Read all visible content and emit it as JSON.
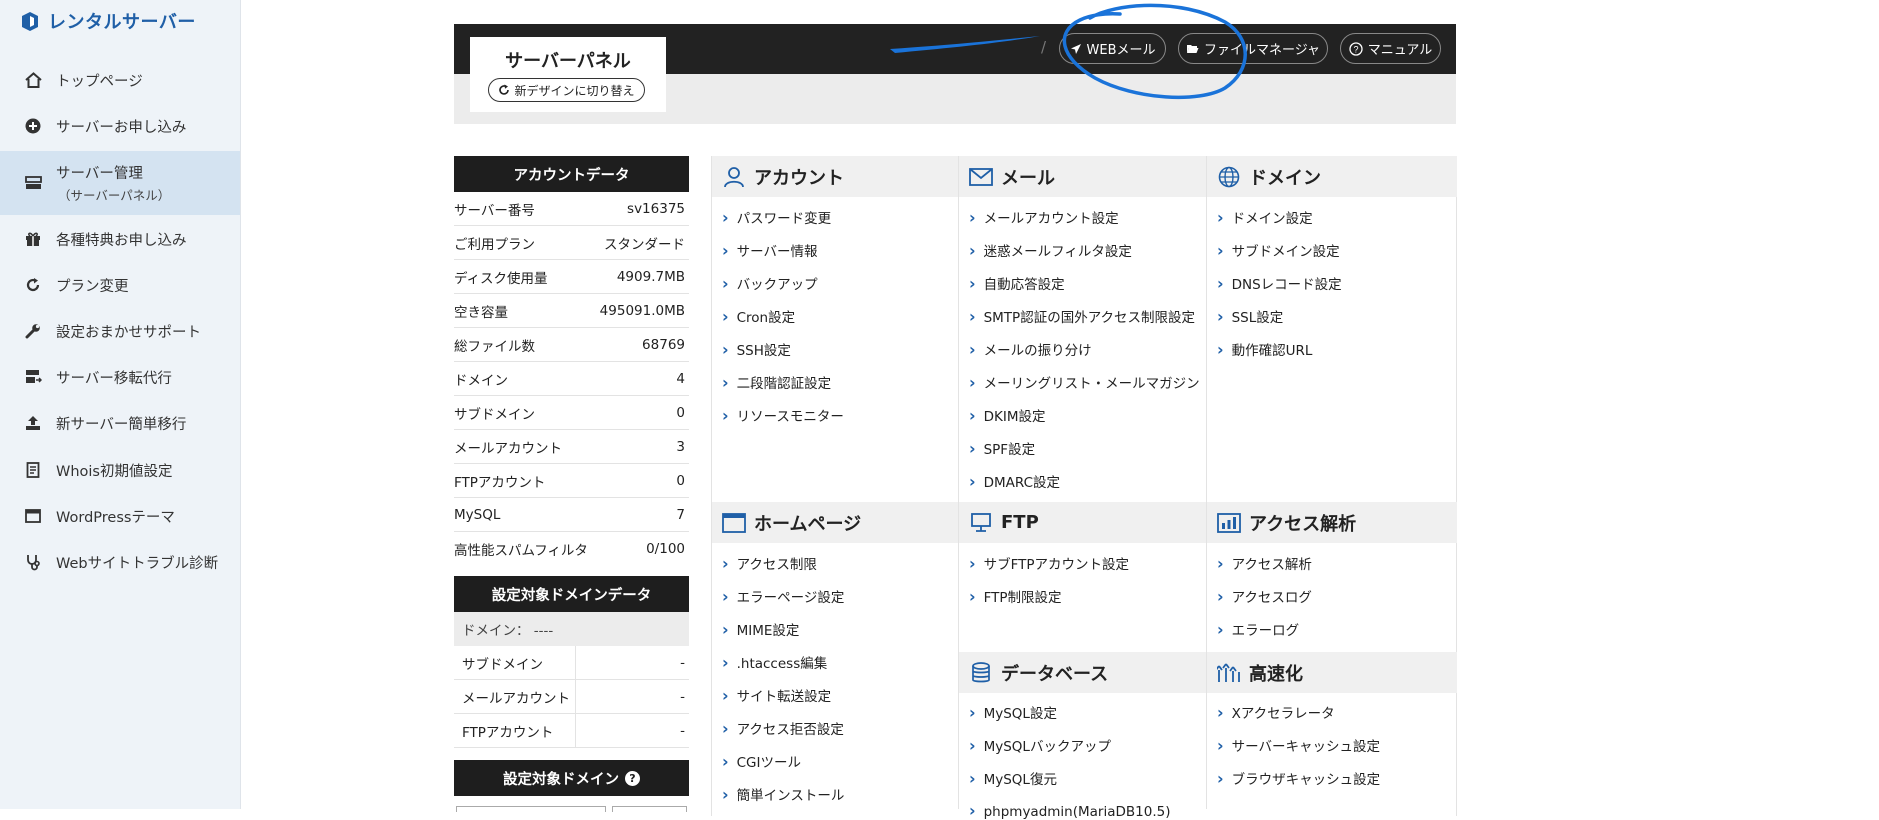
{
  "sidebar": {
    "brand": "レンタルサーバー",
    "items": [
      {
        "label": "トップページ",
        "icon": "home-icon"
      },
      {
        "label": "サーバーお申し込み",
        "icon": "plus-circle-icon"
      },
      {
        "label": "サーバー管理",
        "sub": "（サーバーパネル）",
        "icon": "server-icon",
        "active": true
      },
      {
        "label": "各種特典お申し込み",
        "icon": "gift-icon"
      },
      {
        "label": "プラン変更",
        "icon": "refresh-icon"
      },
      {
        "label": "設定おまかせサポート",
        "icon": "wrench-icon"
      },
      {
        "label": "サーバー移転代行",
        "icon": "server-transfer-icon"
      },
      {
        "label": "新サーバー簡単移行",
        "icon": "upload-icon"
      },
      {
        "label": "Whois初期値設定",
        "icon": "document-icon"
      },
      {
        "label": "WordPressテーマ",
        "icon": "window-icon"
      },
      {
        "label": "Webサイトトラブル診断",
        "icon": "diagnose-icon"
      }
    ]
  },
  "header": {
    "title": "サーバーパネル",
    "switch_label": "新デザインに切り替え",
    "slash": "/",
    "webmail_label": "WEBメール",
    "filemanager_label": "ファイルマネージャ",
    "manual_label": "マニュアル"
  },
  "account": {
    "heading": "アカウントデータ",
    "rows": [
      {
        "k": "サーバー番号",
        "v": "sv16375"
      },
      {
        "k": "ご利用プラン",
        "v": "スタンダード"
      },
      {
        "k": "ディスク使用量",
        "v": "4909.7MB"
      },
      {
        "k": "空き容量",
        "v": "495091.0MB"
      },
      {
        "k": "総ファイル数",
        "v": "68769"
      },
      {
        "k": "ドメイン",
        "v": "4"
      },
      {
        "k": "サブドメイン",
        "v": "0"
      },
      {
        "k": "メールアカウント",
        "v": "3"
      },
      {
        "k": "FTPアカウント",
        "v": "0"
      },
      {
        "k": "MySQL",
        "v": "7"
      },
      {
        "k": "高性能スパムフィルタ",
        "v": "0/100"
      }
    ]
  },
  "domain_data": {
    "heading": "設定対象ドメインデータ",
    "domain_line": "ドメイン： ----",
    "rows": [
      {
        "k": "サブドメイン",
        "v": "-"
      },
      {
        "k": "メールアカウント",
        "v": "-"
      },
      {
        "k": "FTPアカウント",
        "v": "-"
      }
    ]
  },
  "target_domain": {
    "heading": "設定対象ドメイン",
    "help": "?"
  },
  "sections": {
    "account": {
      "title": "アカウント",
      "links": [
        "パスワード変更",
        "サーバー情報",
        "バックアップ",
        "Cron設定",
        "SSH設定",
        "二段階認証設定",
        "リソースモニター"
      ]
    },
    "mail": {
      "title": "メール",
      "links": [
        "メールアカウント設定",
        "迷惑メールフィルタ設定",
        "自動応答設定",
        "SMTP認証の国外アクセス制限設定",
        "メールの振り分け",
        "メーリングリスト・メールマガジン",
        "DKIM設定",
        "SPF設定",
        "DMARC設定"
      ]
    },
    "domain": {
      "title": "ドメイン",
      "links": [
        "ドメイン設定",
        "サブドメイン設定",
        "DNSレコード設定",
        "SSL設定",
        "動作確認URL"
      ]
    },
    "homepage": {
      "title": "ホームページ",
      "links": [
        "アクセス制限",
        "エラーページ設定",
        "MIME設定",
        ".htaccess編集",
        "サイト転送設定",
        "アクセス拒否設定",
        "CGIツール",
        "簡単インストール"
      ]
    },
    "ftp": {
      "title": "FTP",
      "links": [
        "サブFTPアカウント設定",
        "FTP制限設定"
      ]
    },
    "analytics": {
      "title": "アクセス解析",
      "links": [
        "アクセス解析",
        "アクセスログ",
        "エラーログ"
      ]
    },
    "database": {
      "title": "データベース",
      "links": [
        "MySQL設定",
        "MySQLバックアップ",
        "MySQL復元",
        "phpmyadmin(MariaDB10.5)"
      ]
    },
    "speed": {
      "title": "高速化",
      "links": [
        "Xアクセラレータ",
        "サーバーキャッシュ設定",
        "ブラウザキャッシュ設定"
      ]
    }
  },
  "colors": {
    "accent": "#1f5fa7",
    "annotation": "#1a73d9",
    "header_bg": "#222222"
  }
}
